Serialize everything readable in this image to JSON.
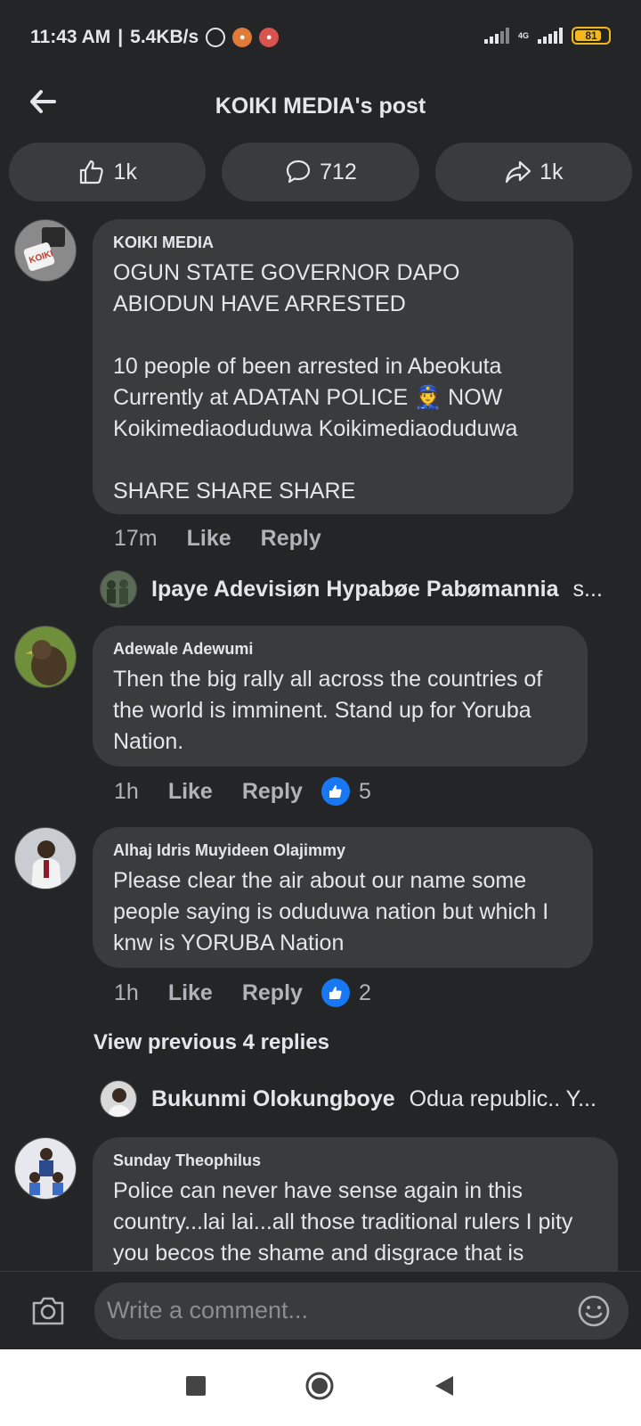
{
  "status_bar": {
    "time": "11:43 AM",
    "net_speed": "5.4KB/s",
    "network_type": "4G",
    "battery": "81",
    "battery_fraction": 0.81
  },
  "header": {
    "title": "KOIKI MEDIA's post",
    "back_icon": "back-arrow-icon"
  },
  "stats": {
    "likes": "1k",
    "comments": "712",
    "shares": "1k"
  },
  "comments": [
    {
      "author": "KOIKI MEDIA",
      "text": "OGUN STATE GOVERNOR DAPO ABIODUN HAVE ARRESTED\n\n10 people of been arrested in Abeokuta Currently at ADATAN POLICE 👮 NOW Koikimediaoduduwa Koikimediaoduduwa\n\nSHARE SHARE SHARE",
      "time": "17m",
      "like_label": "Like",
      "reply_label": "Reply"
    },
    {
      "author": "Adewale Adewumi",
      "text": "Then the big rally all across the countries of the world is imminent. Stand up for Yoruba Nation.",
      "time": "1h",
      "like_label": "Like",
      "reply_label": "Reply",
      "reactions": "5"
    },
    {
      "author": "Alhaj Idris Muyideen Olajimmy",
      "text": "Please clear the air about our name some people saying is oduduwa nation but which I knw is YORUBA Nation",
      "time": "1h",
      "like_label": "Like",
      "reply_label": "Reply",
      "reactions": "2"
    },
    {
      "author": "Sunday Theophilus",
      "text": "Police can never have sense again in this country...lai lai...all those traditional rulers I pity you becos the shame and disgrace that is"
    }
  ],
  "reply_previews": [
    {
      "name": "Ipaye Adevisiøn Hypabøe Pabømannia",
      "snippet": "s..."
    },
    {
      "name": "Bukunmi Olokungboye",
      "snippet": "Odua republic.. Y..."
    }
  ],
  "view_previous": "View previous 4 replies",
  "composer": {
    "placeholder": "Write a comment...",
    "camera_icon": "camera-icon",
    "emoji_icon": "emoji-icon"
  }
}
